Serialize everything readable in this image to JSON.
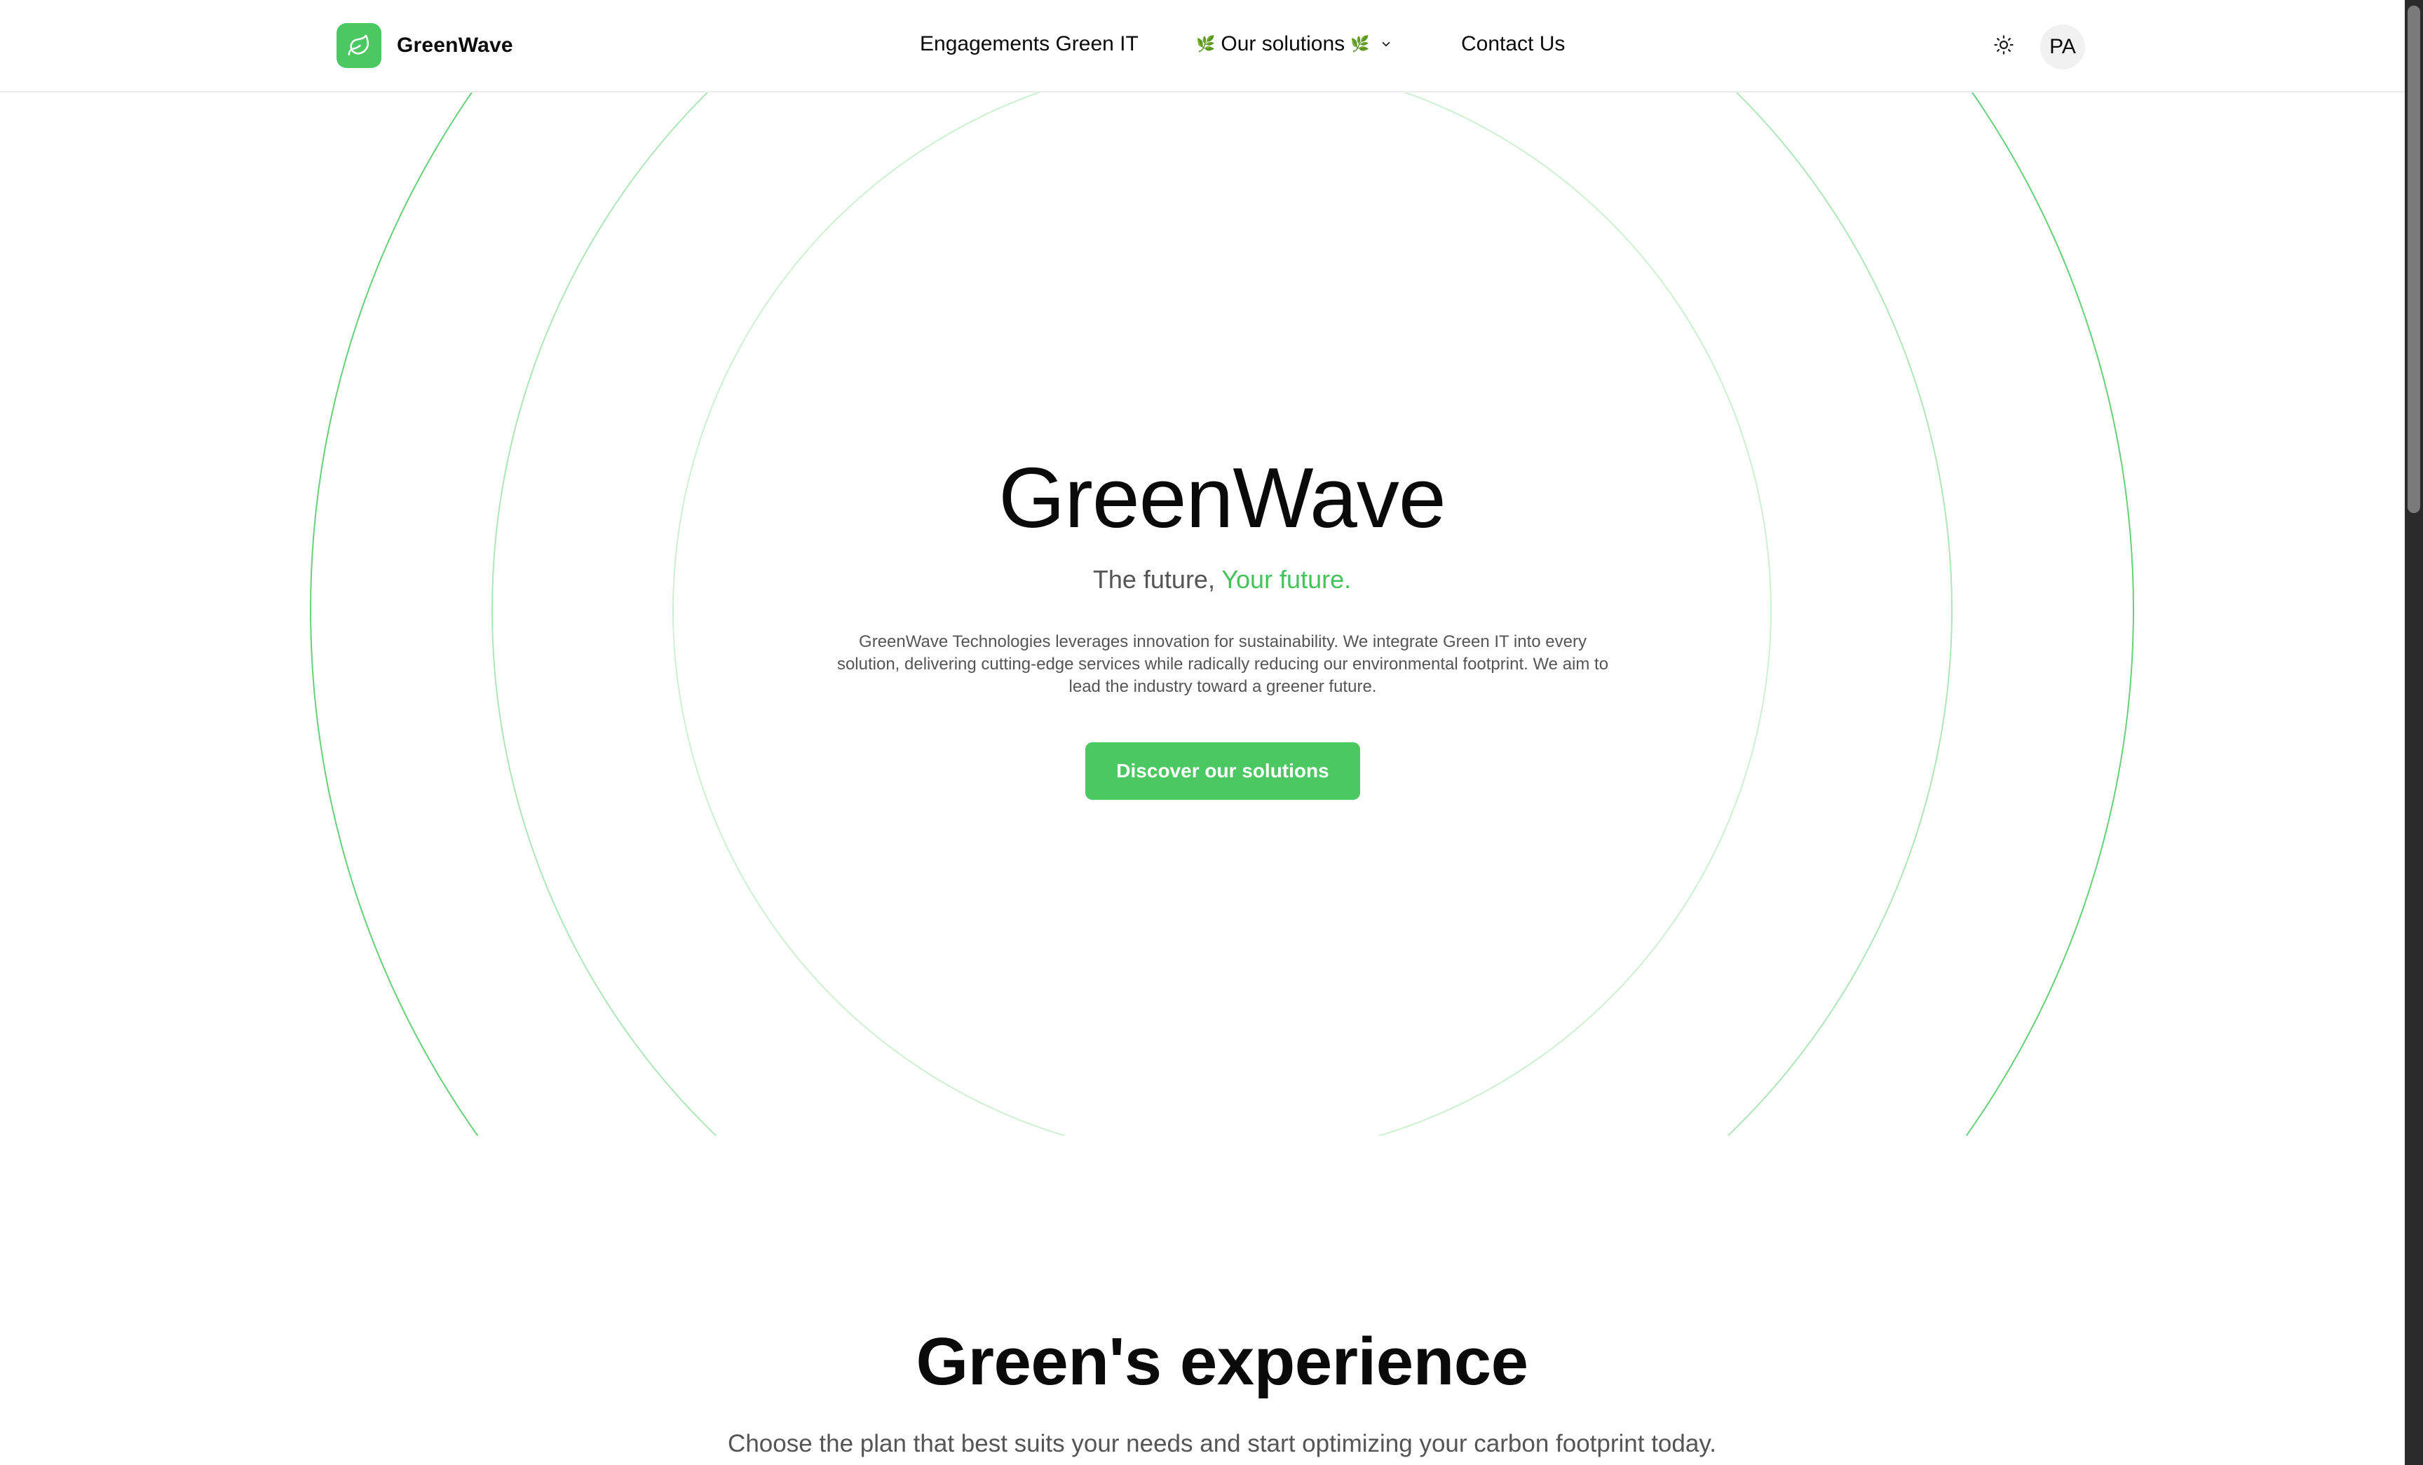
{
  "brand": {
    "name": "GreenWave",
    "logo_icon": "leaf-icon",
    "accent_color": "#4cc862"
  },
  "nav": {
    "engagements_label": "Engagements Green IT",
    "solutions_label": "Our solutions",
    "solutions_emoji": "🌿",
    "solutions_chevron_icon": "chevron-down-icon",
    "contact_label": "Contact Us"
  },
  "header_actions": {
    "theme_toggle_icon": "sun-icon",
    "avatar_initials": "PA"
  },
  "hero": {
    "title": "GreenWave",
    "tagline_prefix": "The future,",
    "tagline_accent": "Your future.",
    "description": "GreenWave Technologies leverages innovation for sustainability. We integrate Green IT into every solution, delivering cutting-edge services while radically reducing our environmental footprint. We aim to lead the industry toward a greener future.",
    "cta_label": "Discover our solutions"
  },
  "section": {
    "title": "Green's experience",
    "subtitle": "Choose the plan that best suits your needs and start optimizing your carbon footprint today."
  }
}
